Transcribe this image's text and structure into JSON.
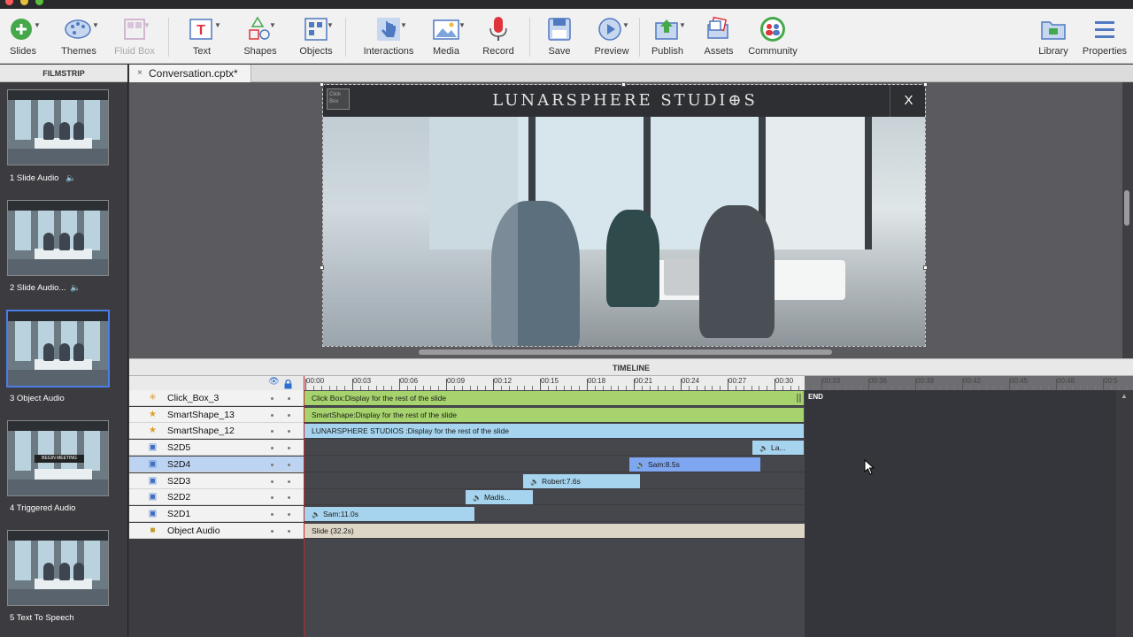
{
  "toolbar": {
    "items": [
      {
        "label": "Slides",
        "icon": "plus-circle-icon"
      },
      {
        "label": "Themes",
        "icon": "palette-icon"
      },
      {
        "label": "Fluid Box",
        "icon": "fluid-box-icon"
      },
      {
        "label": "Text",
        "icon": "text-icon"
      },
      {
        "label": "Shapes",
        "icon": "shapes-icon"
      },
      {
        "label": "Objects",
        "icon": "objects-icon"
      },
      {
        "label": "Interactions",
        "icon": "hand-pointer-icon"
      },
      {
        "label": "Media",
        "icon": "image-icon"
      },
      {
        "label": "Record",
        "icon": "microphone-icon"
      },
      {
        "label": "Save",
        "icon": "floppy-icon"
      },
      {
        "label": "Preview",
        "icon": "play-icon"
      },
      {
        "label": "Publish",
        "icon": "publish-icon"
      },
      {
        "label": "Assets",
        "icon": "assets-icon"
      },
      {
        "label": "Community",
        "icon": "community-icon"
      },
      {
        "label": "Library",
        "icon": "folder-icon"
      },
      {
        "label": "Properties",
        "icon": "menu-icon"
      }
    ]
  },
  "filmstrip": {
    "title": "FILMSTRIP",
    "slides": [
      {
        "label": "1 Slide Audio",
        "audio": true
      },
      {
        "label": "2 Slide Audio...",
        "audio": true
      },
      {
        "label": "3 Object Audio",
        "audio": false,
        "selected": true
      },
      {
        "label": "4 Triggered Audio",
        "audio": false,
        "badge": "BEGIN MEETING"
      },
      {
        "label": "5 Text To Speech",
        "audio": false
      }
    ]
  },
  "document": {
    "tab_close": "×",
    "tab_title": "Conversation.cptx*"
  },
  "slide": {
    "brand": "LUNARSPHERE STUDI⊕S",
    "close": "X",
    "click_box": "Click Box"
  },
  "timeline": {
    "title": "TIMELINE",
    "ruler_labels": [
      "00:00",
      "00:03",
      "00:06",
      "00:09",
      "00:12",
      "00:15",
      "00:18",
      "00:21",
      "00:24",
      "00:27",
      "00:30",
      "00:33",
      "00:36",
      "00:39",
      "00:42",
      "00:45",
      "00:48",
      "00:5"
    ],
    "end_label": "END",
    "rows": [
      {
        "name": "Click_Box_3",
        "icon": "click-box-icon",
        "bar": "Click Box:Display for the rest of the slide",
        "color": "green"
      },
      {
        "name": "SmartShape_13",
        "icon": "star-icon",
        "bar": "SmartShape:Display for the rest of the slide",
        "color": "green"
      },
      {
        "name": "SmartShape_12",
        "icon": "star-icon",
        "bar": "LUNARSPHERE STUDIOS :Display for the rest of the slide",
        "color": "blue"
      },
      {
        "name": "S2D5",
        "icon": "image-icon",
        "bar": "La...",
        "color": "blue",
        "audio": true
      },
      {
        "name": "S2D4",
        "icon": "image-icon",
        "bar": "Sam:8.5s",
        "color": "audiosel",
        "audio": true,
        "selected": true
      },
      {
        "name": "S2D3",
        "icon": "image-icon",
        "bar": "Robert:7.6s",
        "color": "blue",
        "audio": true
      },
      {
        "name": "S2D2",
        "icon": "image-icon",
        "bar": "Madis...",
        "color": "blue",
        "audio": true
      },
      {
        "name": "S2D1",
        "icon": "image-icon",
        "bar": "Sam:11.0s",
        "color": "blue",
        "audio": true
      },
      {
        "name": "Object Audio",
        "icon": "audio-box-icon",
        "bar": "Slide (32.2s)",
        "color": "tan"
      }
    ]
  }
}
